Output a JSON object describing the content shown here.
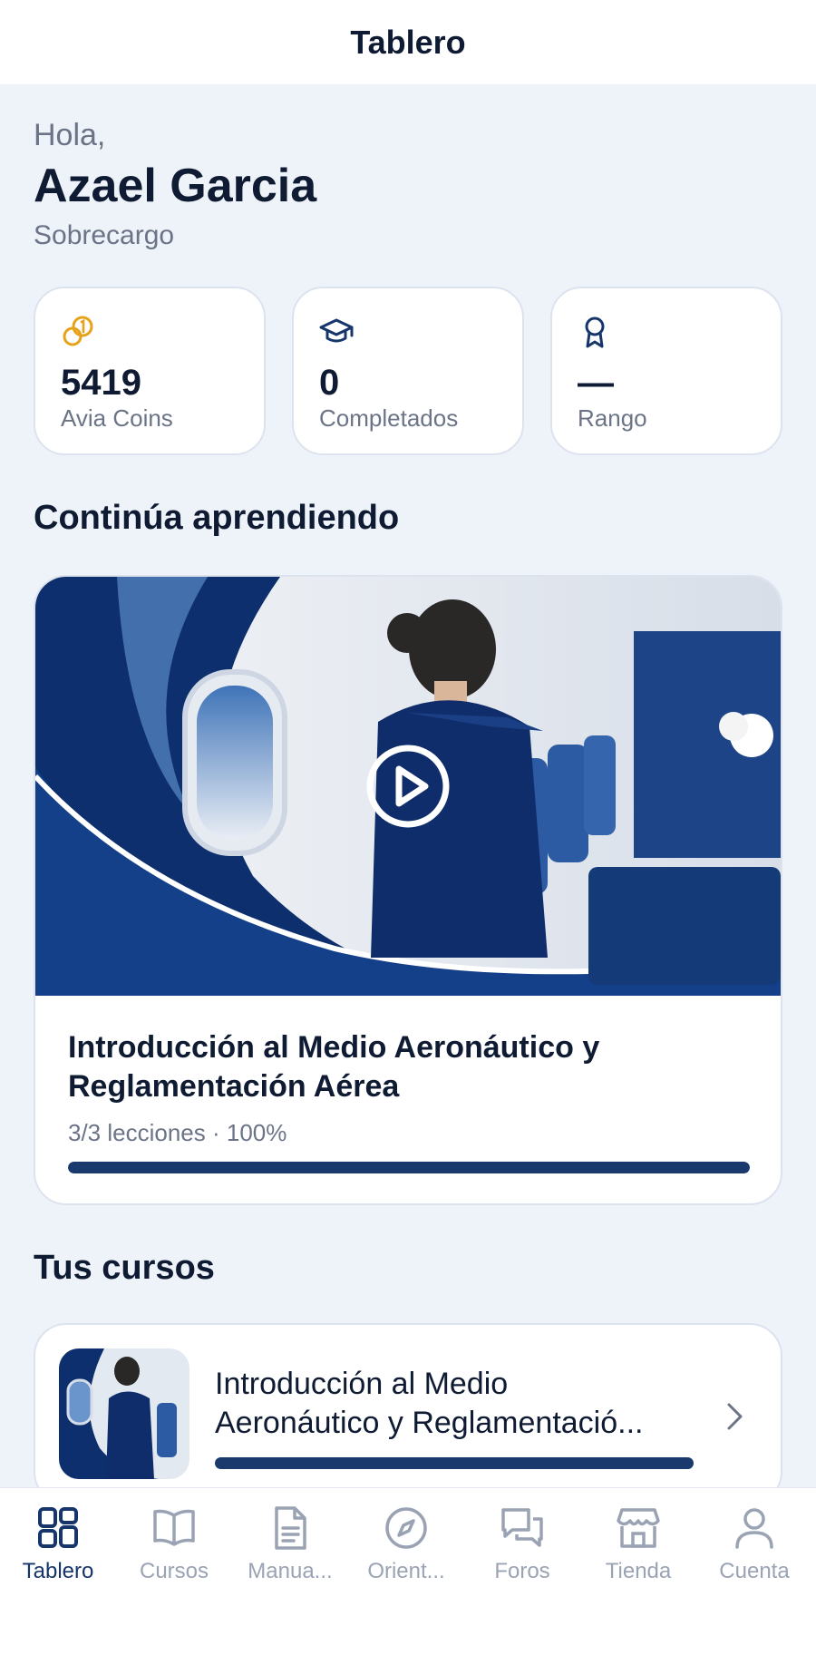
{
  "header": {
    "title": "Tablero"
  },
  "greeting": {
    "hello": "Hola,",
    "name": "Azael Garcia",
    "role": "Sobrecargo"
  },
  "stats": [
    {
      "icon": "coins-icon",
      "value": "5419",
      "label": "Avia Coins"
    },
    {
      "icon": "graduation-cap-icon",
      "value": "0",
      "label": "Completados"
    },
    {
      "icon": "award-icon",
      "value": "—",
      "label": "Rango"
    }
  ],
  "continue": {
    "section_title": "Continúa aprendiendo",
    "course_title": "Introducción al Medio Aeronáutico y Reglamentación Aérea",
    "meta": "3/3 lecciones · 100%",
    "progress": 1.0
  },
  "courses": {
    "section_title": "Tus cursos",
    "items": [
      {
        "title_line1": "Introducción al Medio",
        "title_line2": "Aeronáutico y Reglamentació...",
        "progress": 1.0
      }
    ]
  },
  "tabs": [
    {
      "label": "Tablero",
      "icon": "grid-icon",
      "active": true
    },
    {
      "label": "Cursos",
      "icon": "book-icon",
      "active": false
    },
    {
      "label": "Manua...",
      "icon": "document-icon",
      "active": false
    },
    {
      "label": "Orient...",
      "icon": "compass-icon",
      "active": false
    },
    {
      "label": "Foros",
      "icon": "chat-icon",
      "active": false
    },
    {
      "label": "Tienda",
      "icon": "store-icon",
      "active": false
    },
    {
      "label": "Cuenta",
      "icon": "user-icon",
      "active": false
    }
  ],
  "colors": {
    "accent": "#16356a",
    "coin": "#e5a21a",
    "background": "#eef2f9"
  }
}
